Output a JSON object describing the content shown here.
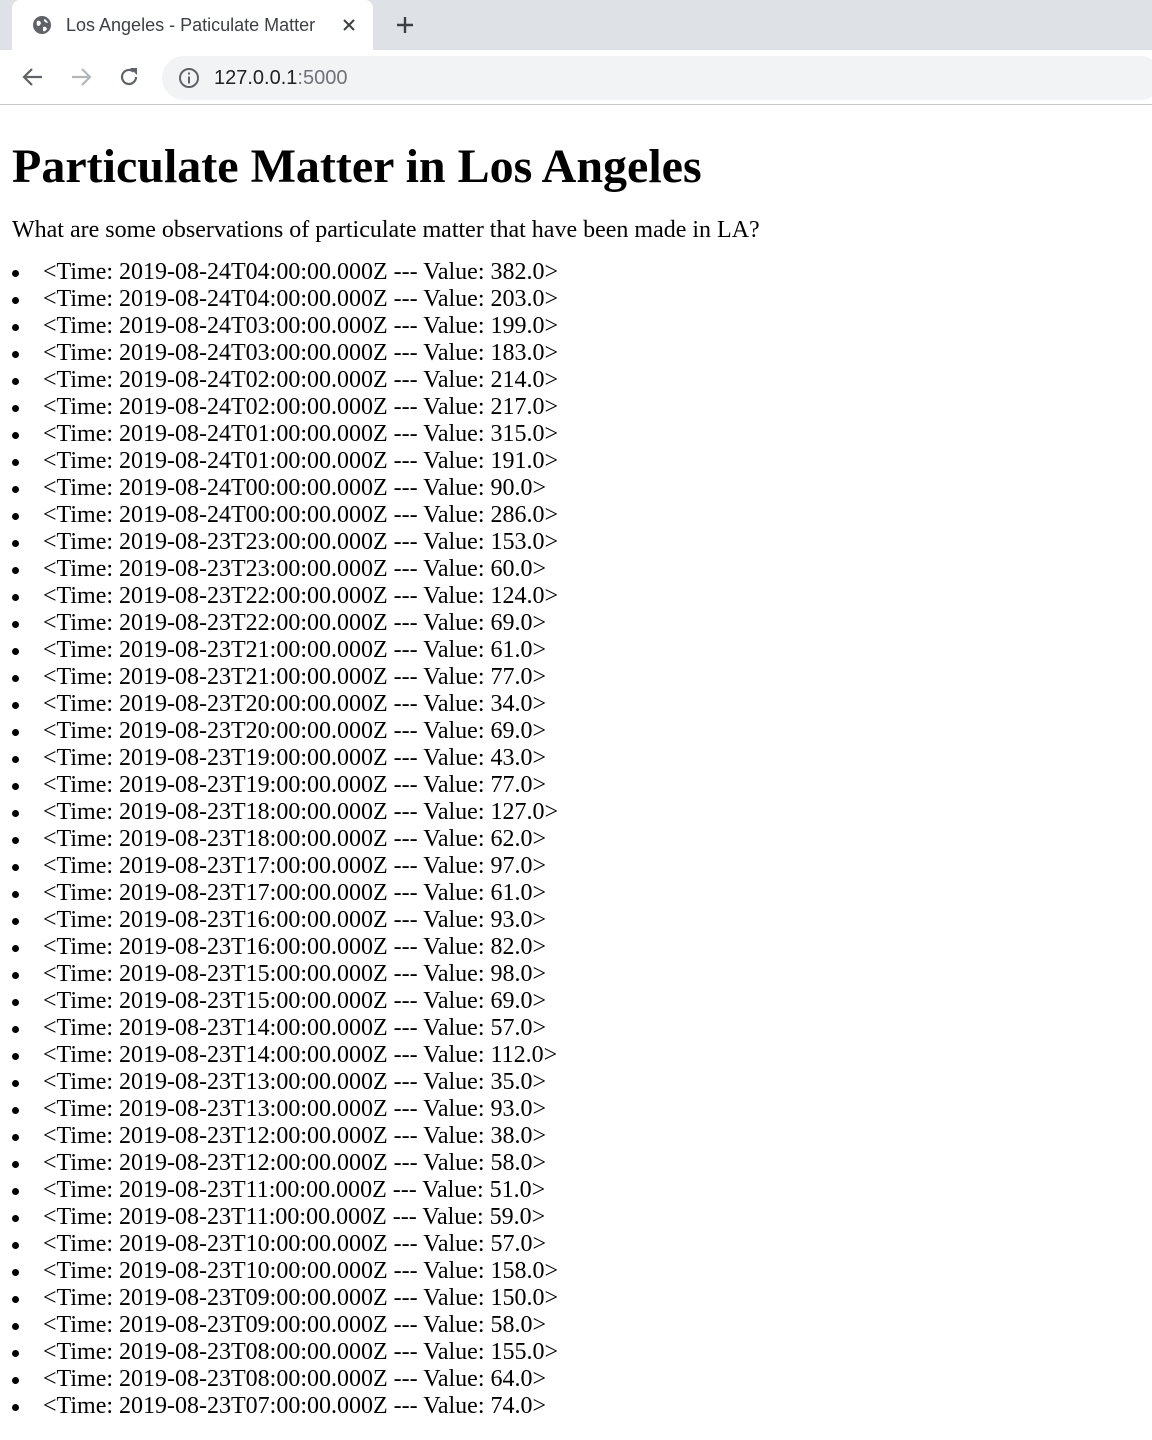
{
  "browser": {
    "tab_title": "Los Angeles - Paticulate Matter",
    "url_host": "127.0.0.1",
    "url_port": ":5000"
  },
  "page": {
    "title": "Particulate Matter in Los Angeles",
    "intro": "What are some observations of particulate matter that have been made in LA?",
    "observations": [
      "<Time: 2019-08-24T04:00:00.000Z --- Value: 382.0>",
      "<Time: 2019-08-24T04:00:00.000Z --- Value: 203.0>",
      "<Time: 2019-08-24T03:00:00.000Z --- Value: 199.0>",
      "<Time: 2019-08-24T03:00:00.000Z --- Value: 183.0>",
      "<Time: 2019-08-24T02:00:00.000Z --- Value: 214.0>",
      "<Time: 2019-08-24T02:00:00.000Z --- Value: 217.0>",
      "<Time: 2019-08-24T01:00:00.000Z --- Value: 315.0>",
      "<Time: 2019-08-24T01:00:00.000Z --- Value: 191.0>",
      "<Time: 2019-08-24T00:00:00.000Z --- Value: 90.0>",
      "<Time: 2019-08-24T00:00:00.000Z --- Value: 286.0>",
      "<Time: 2019-08-23T23:00:00.000Z --- Value: 153.0>",
      "<Time: 2019-08-23T23:00:00.000Z --- Value: 60.0>",
      "<Time: 2019-08-23T22:00:00.000Z --- Value: 124.0>",
      "<Time: 2019-08-23T22:00:00.000Z --- Value: 69.0>",
      "<Time: 2019-08-23T21:00:00.000Z --- Value: 61.0>",
      "<Time: 2019-08-23T21:00:00.000Z --- Value: 77.0>",
      "<Time: 2019-08-23T20:00:00.000Z --- Value: 34.0>",
      "<Time: 2019-08-23T20:00:00.000Z --- Value: 69.0>",
      "<Time: 2019-08-23T19:00:00.000Z --- Value: 43.0>",
      "<Time: 2019-08-23T19:00:00.000Z --- Value: 77.0>",
      "<Time: 2019-08-23T18:00:00.000Z --- Value: 127.0>",
      "<Time: 2019-08-23T18:00:00.000Z --- Value: 62.0>",
      "<Time: 2019-08-23T17:00:00.000Z --- Value: 97.0>",
      "<Time: 2019-08-23T17:00:00.000Z --- Value: 61.0>",
      "<Time: 2019-08-23T16:00:00.000Z --- Value: 93.0>",
      "<Time: 2019-08-23T16:00:00.000Z --- Value: 82.0>",
      "<Time: 2019-08-23T15:00:00.000Z --- Value: 98.0>",
      "<Time: 2019-08-23T15:00:00.000Z --- Value: 69.0>",
      "<Time: 2019-08-23T14:00:00.000Z --- Value: 57.0>",
      "<Time: 2019-08-23T14:00:00.000Z --- Value: 112.0>",
      "<Time: 2019-08-23T13:00:00.000Z --- Value: 35.0>",
      "<Time: 2019-08-23T13:00:00.000Z --- Value: 93.0>",
      "<Time: 2019-08-23T12:00:00.000Z --- Value: 38.0>",
      "<Time: 2019-08-23T12:00:00.000Z --- Value: 58.0>",
      "<Time: 2019-08-23T11:00:00.000Z --- Value: 51.0>",
      "<Time: 2019-08-23T11:00:00.000Z --- Value: 59.0>",
      "<Time: 2019-08-23T10:00:00.000Z --- Value: 57.0>",
      "<Time: 2019-08-23T10:00:00.000Z --- Value: 158.0>",
      "<Time: 2019-08-23T09:00:00.000Z --- Value: 150.0>",
      "<Time: 2019-08-23T09:00:00.000Z --- Value: 58.0>",
      "<Time: 2019-08-23T08:00:00.000Z --- Value: 155.0>",
      "<Time: 2019-08-23T08:00:00.000Z --- Value: 64.0>",
      "<Time: 2019-08-23T07:00:00.000Z --- Value: 74.0>"
    ]
  }
}
